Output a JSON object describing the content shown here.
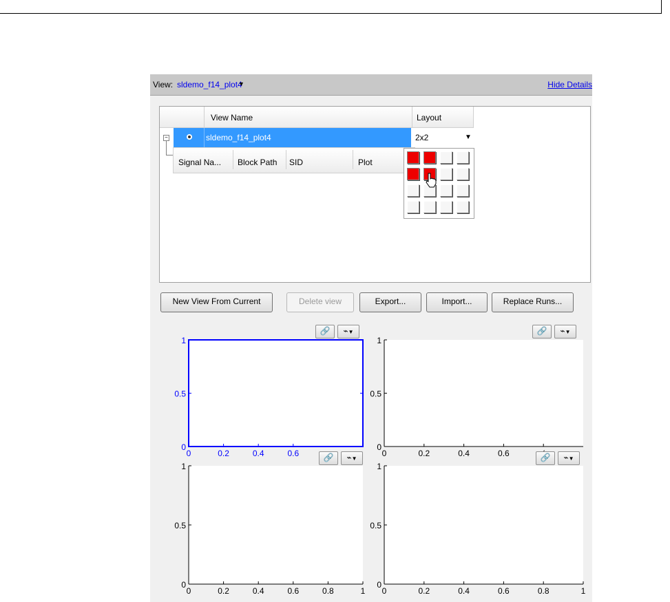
{
  "viewbar": {
    "label": "View:",
    "view_name": "sldemo_f14_plot4",
    "hide_details": "Hide Details"
  },
  "table": {
    "headers": {
      "view_name": "View Name",
      "layout": "Layout"
    },
    "row": {
      "name": "sldemo_f14_plot4",
      "layout": "2x2"
    },
    "sub_headers": [
      "Signal Na...",
      "Block Path",
      "SID",
      "Plot"
    ]
  },
  "layout_grid": {
    "rows": 4,
    "cols": 4,
    "selected_rows": 2,
    "selected_cols": 2
  },
  "buttons": {
    "new_view": "New View From Current",
    "delete_view": "Delete view",
    "export": "Export...",
    "import": "Import...",
    "replace_runs": "Replace Runs..."
  },
  "plots": [
    {
      "xticks": [
        "0",
        "0.2",
        "0.4",
        "0.6"
      ],
      "yticks": [
        "0",
        "0.5",
        "1"
      ],
      "active": true
    },
    {
      "xticks": [
        "0",
        "0.2",
        "0.4",
        "0.6",
        "("
      ],
      "yticks": [
        "0",
        "0.5",
        "1"
      ],
      "active": false
    },
    {
      "xticks": [
        "0",
        "0.2",
        "0.4",
        "0.6",
        "0.8",
        "1"
      ],
      "yticks": [
        "0",
        "0.5",
        "1"
      ],
      "active": false
    },
    {
      "xticks": [
        "0",
        "0.2",
        "0.4",
        "0.6",
        "0.8",
        "1"
      ],
      "yticks": [
        "0",
        "0.5",
        "1"
      ],
      "active": false
    }
  ],
  "colors": {
    "active_axis": "#0000ff",
    "selection": "#3399ff",
    "grid_on": "#ee0000"
  },
  "icons": {
    "link": "link-icon",
    "plot_options": "plot-options-icon",
    "dropdown": "chevron-down-icon",
    "cursor": "hand-cursor-icon"
  }
}
